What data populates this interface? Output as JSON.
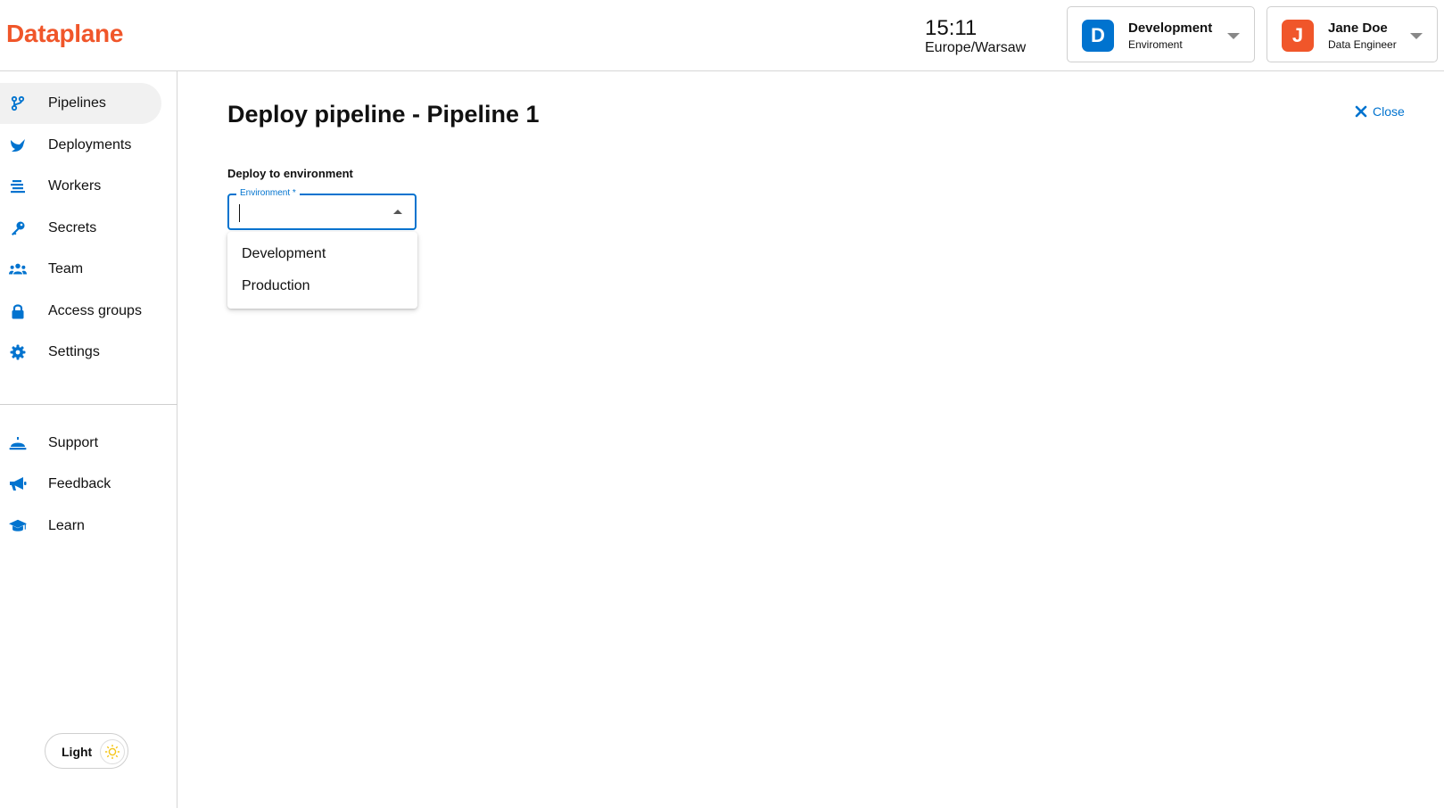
{
  "header": {
    "logo": "Dataplane",
    "clock": {
      "time": "15:11",
      "timezone": "Europe/Warsaw"
    },
    "environment": {
      "badge": "D",
      "title": "Development",
      "subtitle": "Enviroment",
      "color": "#0073cf"
    },
    "user": {
      "badge": "J",
      "name": "Jane Doe",
      "role": "Data Engineer",
      "color": "#f0562a"
    }
  },
  "sidebar": {
    "items": [
      {
        "label": "Pipelines",
        "icon": "pipelines-icon",
        "active": true
      },
      {
        "label": "Deployments",
        "icon": "deployments-icon"
      },
      {
        "label": "Workers",
        "icon": "workers-icon"
      },
      {
        "label": "Secrets",
        "icon": "key-icon"
      },
      {
        "label": "Team",
        "icon": "team-icon"
      },
      {
        "label": "Access groups",
        "icon": "lock-icon"
      },
      {
        "label": "Settings",
        "icon": "gear-icon"
      }
    ],
    "secondary": [
      {
        "label": "Support",
        "icon": "support-icon"
      },
      {
        "label": "Feedback",
        "icon": "megaphone-icon"
      },
      {
        "label": "Learn",
        "icon": "graduation-cap-icon"
      }
    ],
    "theme": {
      "label": "Light",
      "icon": "sun-icon"
    }
  },
  "main": {
    "title": "Deploy pipeline - Pipeline 1",
    "close_label": "Close",
    "section_label": "Deploy to environment",
    "environment_field": {
      "label": "Environment",
      "required_mark": "*",
      "value": ""
    },
    "options": [
      "Development",
      "Production"
    ]
  },
  "colors": {
    "brand": "#f0562a",
    "accent": "#0073cf"
  }
}
